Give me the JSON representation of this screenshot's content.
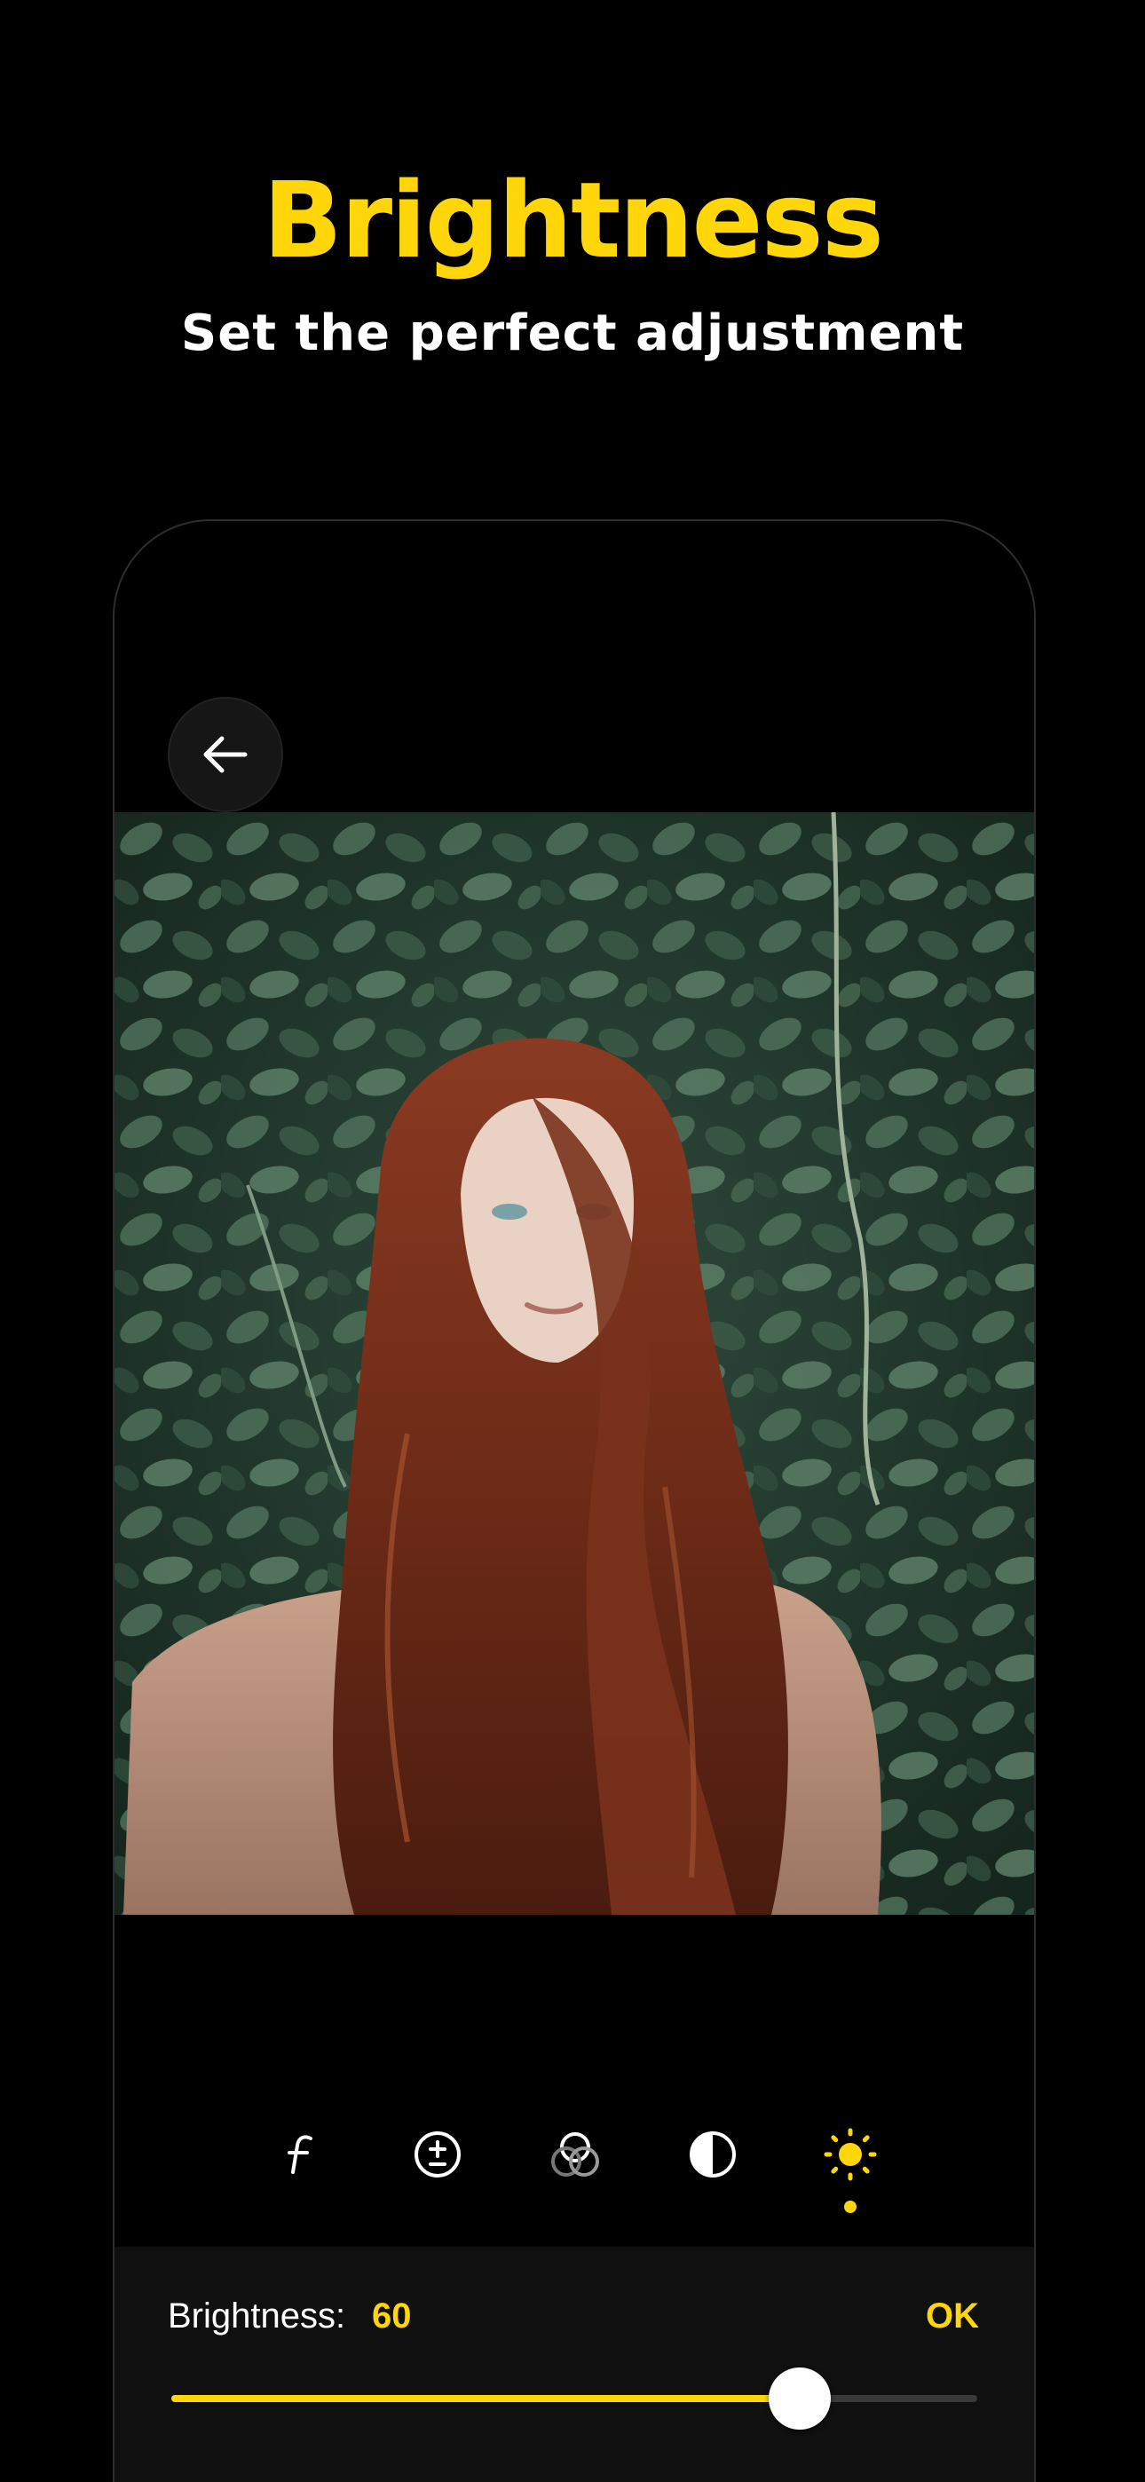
{
  "promo": {
    "title": "Brightness",
    "subtitle": "Set the perfect adjustment"
  },
  "editor": {
    "back_icon": "arrow-left-icon",
    "tools": [
      {
        "name": "aperture",
        "icon": "f-stop-icon",
        "active": false
      },
      {
        "name": "exposure",
        "icon": "plus-minus-icon",
        "active": false
      },
      {
        "name": "color-mix",
        "icon": "overlapping-circles-icon",
        "active": false
      },
      {
        "name": "contrast",
        "icon": "half-circle-icon",
        "active": false
      },
      {
        "name": "brightness",
        "icon": "sun-icon",
        "active": true
      }
    ],
    "adjustment": {
      "label": "Brightness:",
      "value": "60",
      "ok_label": "OK",
      "slider_fraction": 0.78
    }
  },
  "colors": {
    "accent": "#FFD60A",
    "background": "#000000",
    "panel": "#101010"
  }
}
